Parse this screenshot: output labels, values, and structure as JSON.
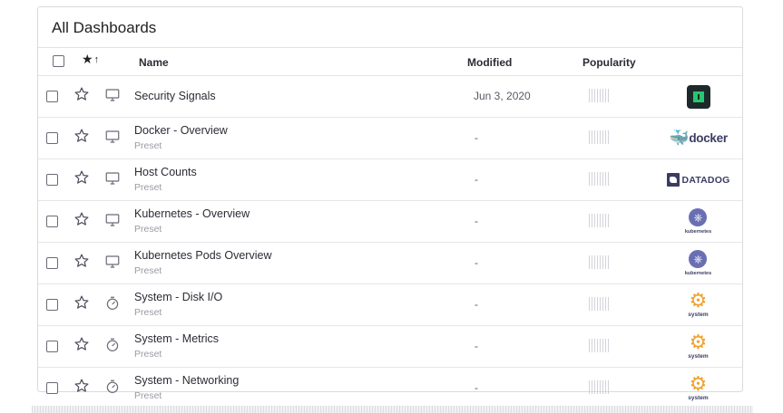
{
  "panel": {
    "title": "All Dashboards"
  },
  "header": {
    "star_sort_icon": "★",
    "sort_arrow": "↑",
    "name": "Name",
    "modified": "Modified",
    "popularity": "Popularity"
  },
  "rows": [
    {
      "name": "Security Signals",
      "subtitle": "",
      "type_icon": "monitor-icon",
      "modified": "Jun 3, 2020",
      "logo": "security-signals-logo"
    },
    {
      "name": "Docker - Overview",
      "subtitle": "Preset",
      "type_icon": "monitor-icon",
      "modified": "-",
      "logo": "docker-logo",
      "logo_text": "docker"
    },
    {
      "name": "Host Counts",
      "subtitle": "Preset",
      "type_icon": "monitor-icon",
      "modified": "-",
      "logo": "datadog-logo",
      "logo_text": "DATADOG"
    },
    {
      "name": "Kubernetes - Overview",
      "subtitle": "Preset",
      "type_icon": "monitor-icon",
      "modified": "-",
      "logo": "kubernetes-logo",
      "logo_text": "kubernetes"
    },
    {
      "name": "Kubernetes Pods Overview",
      "subtitle": "Preset",
      "type_icon": "monitor-icon",
      "modified": "-",
      "logo": "kubernetes-logo",
      "logo_text": "kubernetes"
    },
    {
      "name": "System - Disk I/O",
      "subtitle": "Preset",
      "type_icon": "stopwatch-icon",
      "modified": "-",
      "logo": "system-logo",
      "logo_text": "system"
    },
    {
      "name": "System - Metrics",
      "subtitle": "Preset",
      "type_icon": "stopwatch-icon",
      "modified": "-",
      "logo": "system-logo",
      "logo_text": "system"
    },
    {
      "name": "System - Networking",
      "subtitle": "Preset",
      "type_icon": "stopwatch-icon",
      "modified": "-",
      "logo": "system-logo",
      "logo_text": "system"
    }
  ],
  "colors": {
    "text": "#2b2b35",
    "muted": "#9a9aa5",
    "border": "#e3e3e8",
    "icon": "#6b6b78",
    "system_orange": "#f0a22d",
    "kubernetes_purple": "#6a6fb3",
    "security_green": "#28c76f"
  }
}
